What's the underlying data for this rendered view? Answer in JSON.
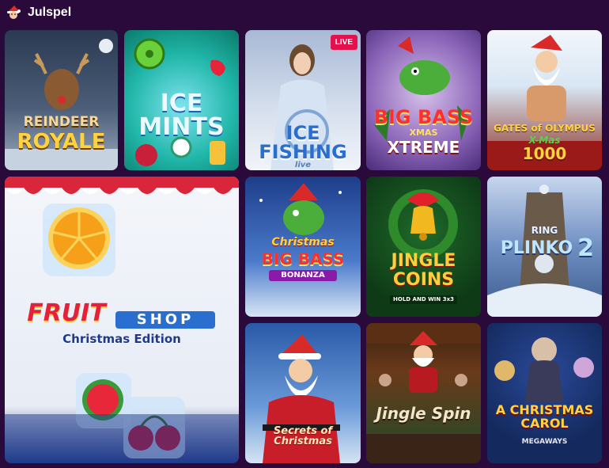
{
  "header": {
    "title": "Julspel",
    "icon": "santa-icon"
  },
  "games": {
    "reindeer": {
      "line1": "REINDEER",
      "line2": "ROYALE"
    },
    "icemints": {
      "line1": "ICE",
      "line2": "MINTS"
    },
    "icefishing": {
      "line1": "ICE",
      "line2": "FISHING",
      "line3": "live",
      "badge": "LIVE"
    },
    "bigbassxmas": {
      "line1": "BIG BASS",
      "line2": "XMAS",
      "line3": "XTREME"
    },
    "gates": {
      "line1": "GATES of OLYMPUS",
      "line2": "X-Mas",
      "line3": "1000"
    },
    "fruitshop": {
      "line1": "FRUIT",
      "line2": "SHOP",
      "line3": "Christmas Edition"
    },
    "christmasbigbass": {
      "line1": "Christmas",
      "line2": "BIG BASS",
      "line3": "BONANZA"
    },
    "jinglecoins": {
      "line1": "JINGLE",
      "line2": "COINS",
      "line3": "HOLD AND WIN 3x3"
    },
    "plinko": {
      "line1": "RING",
      "line2": "PLINKO",
      "line3": "2"
    },
    "secrets": {
      "line1": "Secrets of Christmas"
    },
    "jinglespin": {
      "line1": "Jingle Spin"
    },
    "carol": {
      "line1": "A CHRISTMAS CAROL",
      "line2": "MEGAWAYS"
    }
  }
}
